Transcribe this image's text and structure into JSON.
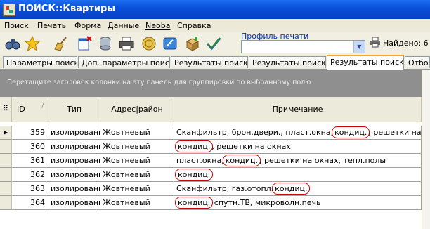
{
  "window": {
    "title": "ПОИСК::Квартиры"
  },
  "menu": [
    "Поиск",
    "Печать",
    "Форма",
    "Данные",
    "Neoba",
    "Справка"
  ],
  "toolbar": {
    "icons": [
      "binoculars-icon",
      "star-icon",
      "broom-icon",
      "new-doc-icon",
      "database-icon",
      "printer-icon",
      "seal-icon",
      "edit-icon",
      "box-icon",
      "checkmark-icon"
    ],
    "profile_label": "Профиль печати",
    "profile_value": "",
    "found_label": "Найдено: 6"
  },
  "tabs": [
    "Параметры поиска",
    "Доп. параметры поиска",
    "Результаты поиска",
    "Результаты поиска",
    "Результаты поиска",
    "Отбор"
  ],
  "group_panel": "Перетащите заголовок колонки на эту панель для группировки по выбранному полю",
  "table": {
    "headers": {
      "id": "ID",
      "type": "Тип",
      "address": "Адрес|район",
      "note": "Примечание"
    },
    "rows": [
      {
        "id": "359",
        "type": "изолированная",
        "address": "Жовтневый",
        "note": [
          {
            "t": "Сканфильтр, брон.двери., пласт.окна,"
          },
          {
            "t": "кондиц.",
            "hl": true
          },
          {
            "t": ", решетки на окнах"
          }
        ]
      },
      {
        "id": "360",
        "type": "изолированная",
        "address": "Жовтневый",
        "note": [
          {
            "t": "кондиц.",
            "hl": true
          },
          {
            "t": ", решетки на окнах"
          }
        ]
      },
      {
        "id": "361",
        "type": "изолированная",
        "address": "Жовтневый",
        "note": [
          {
            "t": "пласт.окна,"
          },
          {
            "t": "кондиц.",
            "hl": true
          },
          {
            "t": ", решетки на окнах, тепл.полы"
          }
        ]
      },
      {
        "id": "362",
        "type": "изолированная",
        "address": "Жовтневый",
        "note": [
          {
            "t": "кондиц.",
            "hl": true
          }
        ]
      },
      {
        "id": "363",
        "type": "изолированная",
        "address": "Жовтневый",
        "note": [
          {
            "t": "Сканфильтр, газ.отопл."
          },
          {
            "t": "кондиц.",
            "hl": true
          }
        ]
      },
      {
        "id": "364",
        "type": "изолированная",
        "address": "Жовтневый",
        "note": [
          {
            "t": "кондиц.",
            "hl": true
          },
          {
            "t": " спутн.ТВ, микроволн.печь"
          }
        ]
      }
    ]
  }
}
